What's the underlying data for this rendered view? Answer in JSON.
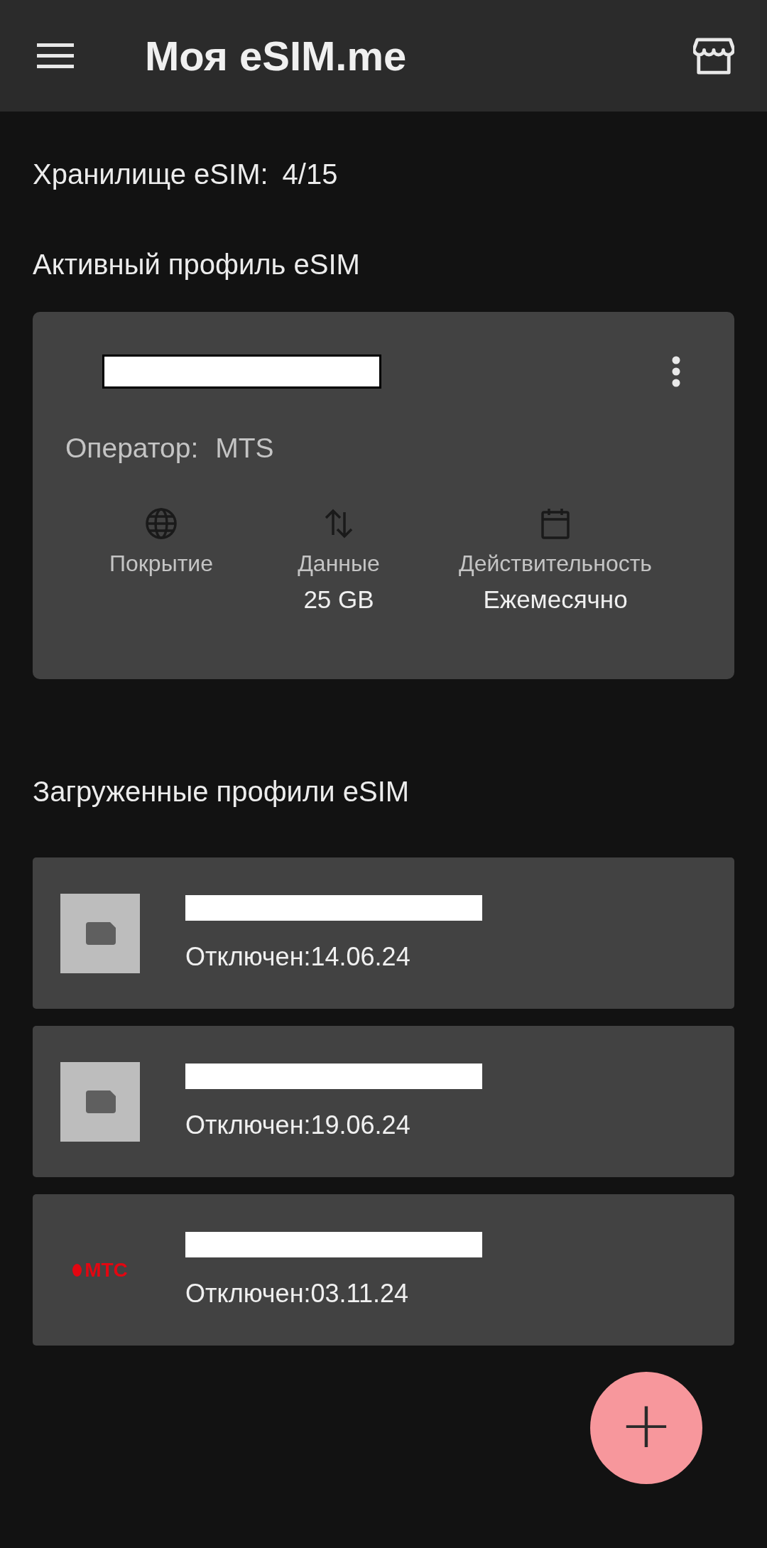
{
  "app_bar": {
    "title": "Моя eSIM.me"
  },
  "storage": {
    "label": "Хранилище eSIM:",
    "value": "4/15"
  },
  "active_section": {
    "title": "Активный профиль eSIM"
  },
  "active_profile": {
    "operator_label": "Оператор:",
    "operator": "MTS",
    "stats": [
      {
        "kind": "globe",
        "label": "Покрытие"
      },
      {
        "kind": "transfer",
        "label": "Данные",
        "value": "25 GB"
      },
      {
        "kind": "calendar",
        "label": "Действительность",
        "value": "Ежемесячно"
      }
    ]
  },
  "loaded_section": {
    "title": "Загруженные профили eSIM"
  },
  "profiles": [
    {
      "kind": "sim",
      "status": "Отключен:14.06.24"
    },
    {
      "kind": "sim",
      "status": "Отключен:19.06.24"
    },
    {
      "kind": "logo",
      "logo": "МТС",
      "status": "Отключен:03.11.24"
    }
  ],
  "fab": {
    "label": "+"
  }
}
